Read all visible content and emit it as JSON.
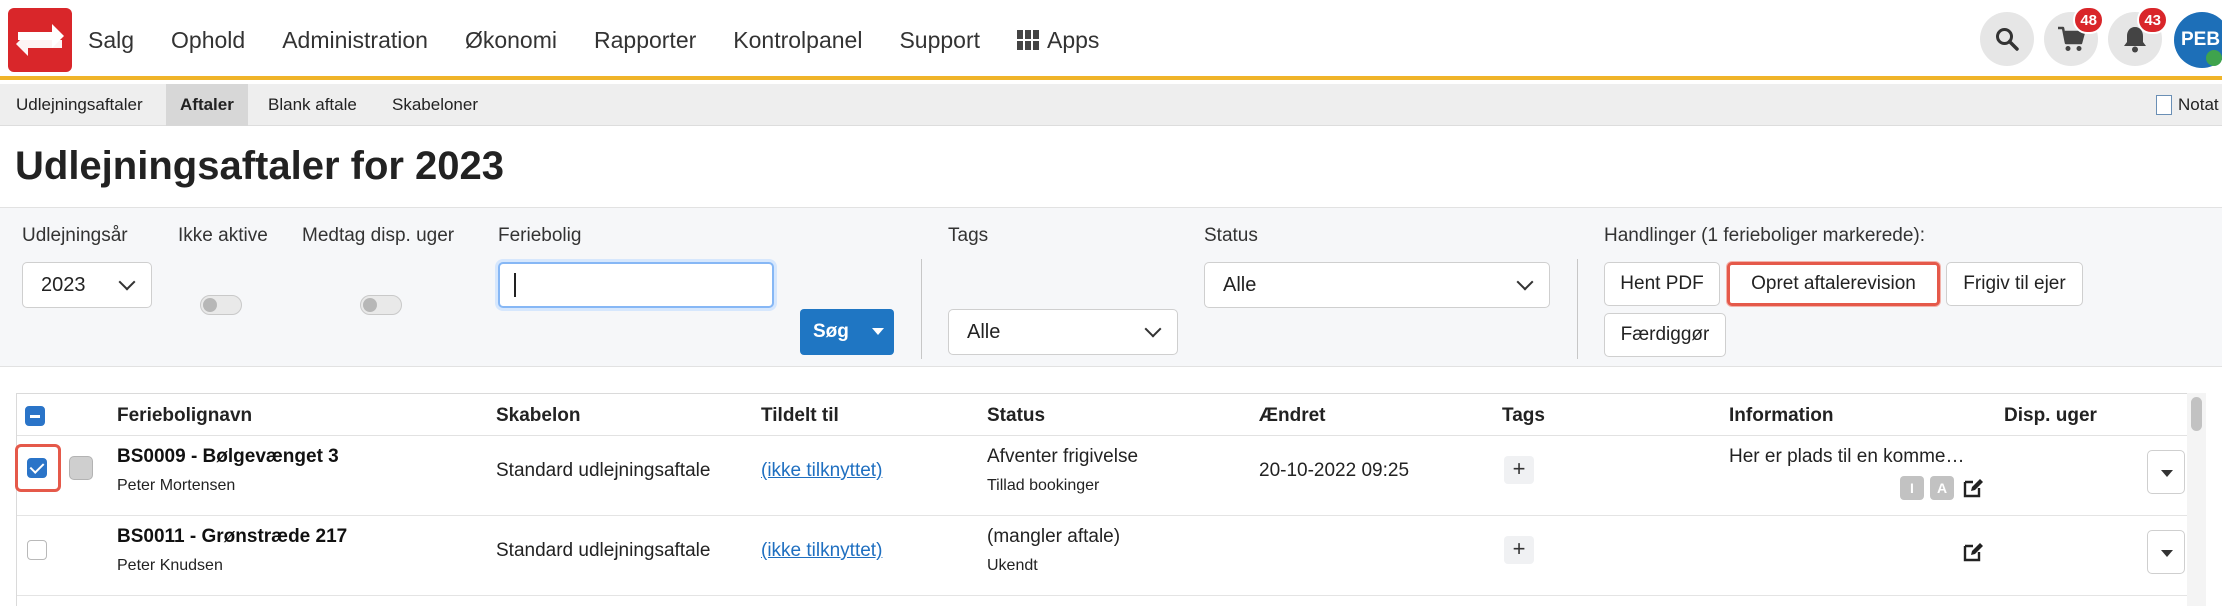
{
  "nav": {
    "items": [
      "Salg",
      "Ophold",
      "Administration",
      "Økonomi",
      "Rapporter",
      "Kontrolpanel",
      "Support",
      "Apps"
    ],
    "cart_count": "48",
    "notifications_count": "43",
    "avatar_initials": "PEB"
  },
  "subnav": {
    "tabs": [
      "Udlejningsaftaler",
      "Aftaler",
      "Blank aftale",
      "Skabeloner"
    ],
    "active_tab": "Aftaler",
    "notat_label": "Notat"
  },
  "page": {
    "title": "Udlejningsaftaler for 2023"
  },
  "filters": {
    "year_label": "Udlejningsår",
    "year_value": "2023",
    "inactive_label": "Ikke aktive",
    "disp_label": "Medtag disp. uger",
    "feriebolig_label": "Feriebolig",
    "feriebolig_value": "",
    "search_button": "Søg",
    "tags_label": "Tags",
    "tags_value": "Alle",
    "status_label": "Status",
    "status_value": "Alle",
    "actions_label": "Handlinger (1 ferieboliger markerede):",
    "actions": [
      "Hent PDF",
      "Opret aftalerevision",
      "Frigiv til ejer",
      "Færdiggør"
    ]
  },
  "table": {
    "headers": [
      "Feriebolignavn",
      "Skabelon",
      "Tildelt til",
      "Status",
      "Ændret",
      "Tags",
      "Information",
      "Disp. uger"
    ],
    "rows": [
      {
        "name": "BS0009 - Bølgevænget 3",
        "owner": "Peter Mortensen",
        "template": "Standard udlejningsaftale",
        "assigned": "(ikke tilknyttet)",
        "status": "Afventer frigivelse",
        "status_sub": "Tillad bookinger",
        "changed": "20-10-2022 09:25",
        "tags": "+",
        "info": "Her er plads til en komme…",
        "info_chips": [
          "I",
          "A"
        ],
        "checked": true
      },
      {
        "name": "BS0011 - Grønstræde 217",
        "owner": "Peter Knudsen",
        "template": "Standard udlejningsaftale",
        "assigned": "(ikke tilknyttet)",
        "status": "(mangler aftale)",
        "status_sub": "Ukendt",
        "changed": "",
        "tags": "+",
        "info": "",
        "info_chips": [],
        "checked": false
      }
    ]
  },
  "colors": {
    "brand_red": "#d9262a",
    "accent_yellow": "#f0b429",
    "primary_blue": "#1f76c3",
    "highlight": "#e5594a"
  }
}
